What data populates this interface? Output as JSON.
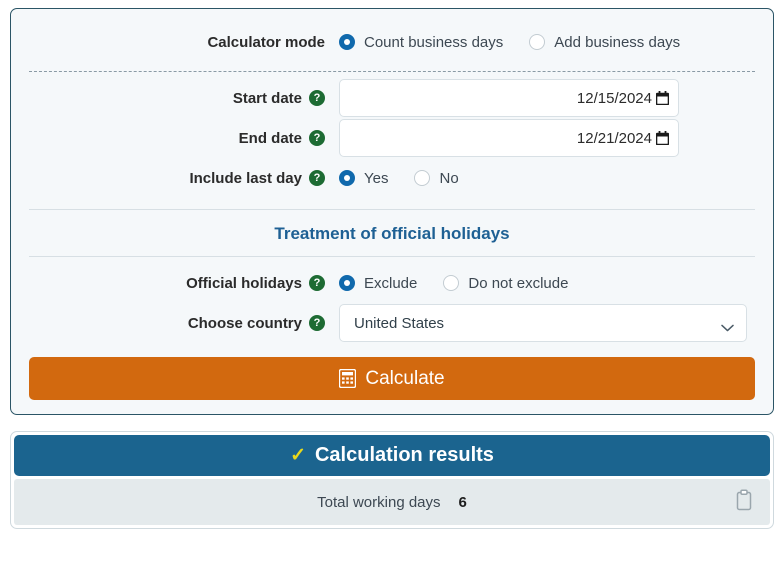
{
  "form": {
    "rows": {
      "mode": {
        "label": "Calculator mode",
        "options": [
          {
            "label": "Count business days",
            "selected": true
          },
          {
            "label": "Add business days",
            "selected": false
          }
        ]
      },
      "start_date": {
        "label": "Start date",
        "help": "?",
        "value": "12/15/2024",
        "icon": "calendar-icon"
      },
      "end_date": {
        "label": "End date",
        "help": "?",
        "value": "12/21/2024",
        "icon": "calendar-icon"
      },
      "include_last_day": {
        "label": "Include last day",
        "help": "?",
        "options": [
          {
            "label": "Yes",
            "selected": true
          },
          {
            "label": "No",
            "selected": false
          }
        ]
      },
      "official_holidays": {
        "label": "Official holidays",
        "help": "?",
        "options": [
          {
            "label": "Exclude",
            "selected": true
          },
          {
            "label": "Do not exclude",
            "selected": false
          }
        ]
      },
      "choose_country": {
        "label": "Choose country",
        "help": "?",
        "value": "United States",
        "icon": "chevron-down-icon"
      }
    },
    "section_title": "Treatment of official holidays",
    "calculate_button": {
      "label": "Calculate",
      "icon": "calculator-icon",
      "color": "#d2690f"
    }
  },
  "results": {
    "header": {
      "title": "Calculation results",
      "check": "✓",
      "check_color": "#e8d81c",
      "bg_color": "#1b648f"
    },
    "total": {
      "label": "Total working days",
      "value": "6"
    },
    "copy_icon": "clipboard-icon"
  }
}
